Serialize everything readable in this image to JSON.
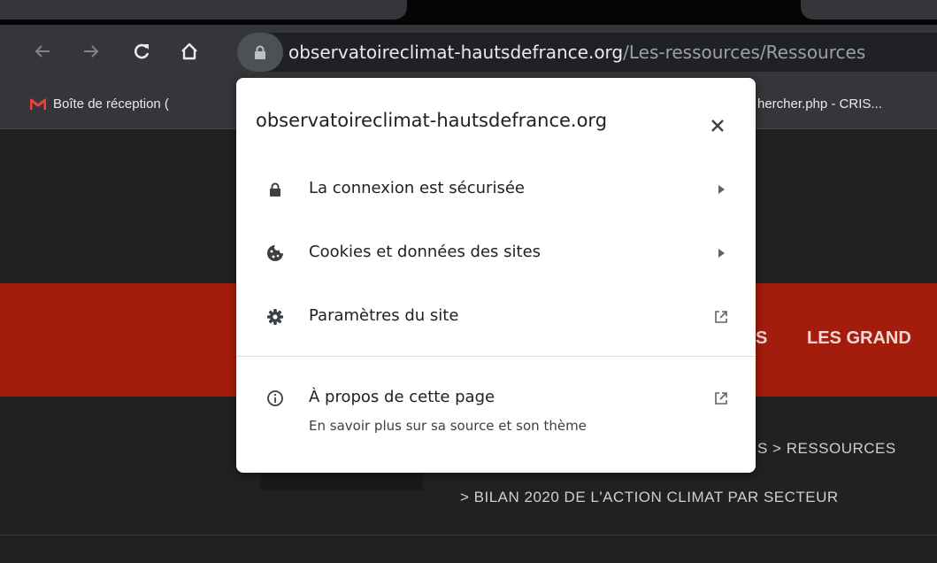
{
  "browser": {
    "url_host": "observatoireclimat-hautsdefrance.org",
    "url_path": "/Les-ressources/Ressources",
    "icons": [
      "back-arrow-icon",
      "forward-arrow-icon",
      "reload-icon",
      "home-icon",
      "lock-icon"
    ]
  },
  "bookmarks": [
    {
      "label": "Boîte de réception (",
      "icon": "gmail-icon"
    },
    {
      "label": "hercher.php - CRIS..."
    }
  ],
  "page": {
    "nav_items": [
      "S",
      "LES GRAND"
    ],
    "breadcrumb_line1": "S  >  RESSOURCES",
    "breadcrumb_line2": ">  BILAN 2020 DE L'ACTION CLIMAT PAR SECTEUR",
    "accent": "#a41c0c"
  },
  "popup": {
    "title": "observatoireclimat-hautsdefrance.org",
    "items": [
      {
        "label": "La connexion est sécurisée",
        "icon": "lock-icon",
        "trailing": "arrow-right-icon"
      },
      {
        "label": "Cookies et données des sites",
        "icon": "cookie-icon",
        "trailing": "arrow-right-icon"
      },
      {
        "label": "Paramètres du site",
        "icon": "gear-icon",
        "trailing": "external-link-icon"
      },
      {
        "label": "À propos de cette page",
        "sublabel": "En savoir plus sur sa source et son thème",
        "icon": "info-icon",
        "trailing": "external-link-icon"
      }
    ]
  }
}
